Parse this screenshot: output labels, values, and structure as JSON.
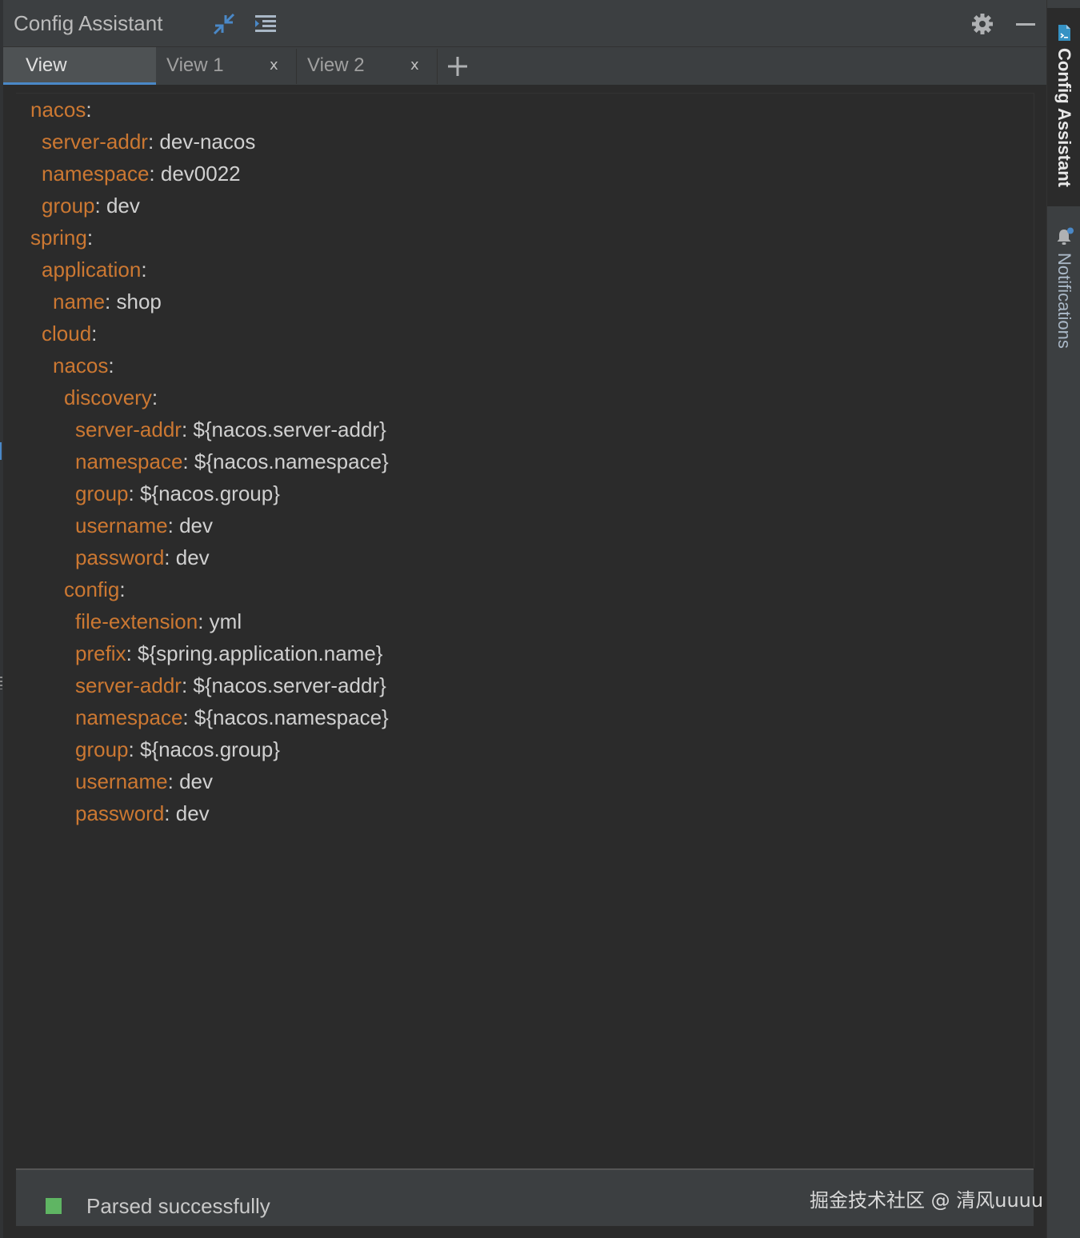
{
  "window": {
    "title": "Config Assistant"
  },
  "toolbar": {
    "collapse_icon": "collapse-arrows-icon",
    "outline_icon": "indent-list-icon",
    "settings_icon": "gear-icon",
    "minimize_icon": "minimize-icon"
  },
  "tabs": [
    {
      "label": "View",
      "active": true,
      "closable": false
    },
    {
      "label": "View 1",
      "active": false,
      "closable": true,
      "close": "x"
    },
    {
      "label": "View 2",
      "active": false,
      "closable": true,
      "close": "x"
    }
  ],
  "add_tab": "+",
  "editor": {
    "lines": [
      {
        "key": "nacos",
        "sep": ":",
        "value": ""
      },
      {
        "key": "server-addr",
        "sep": ":",
        "value": " dev-nacos"
      },
      {
        "key": "namespace",
        "sep": ":",
        "value": " dev0022"
      },
      {
        "key": "group",
        "sep": ":",
        "value": " dev"
      },
      {
        "key": "spring",
        "sep": ":",
        "value": ""
      },
      {
        "key": "application",
        "sep": ":",
        "value": ""
      },
      {
        "key": "name",
        "sep": ":",
        "value": " shop"
      },
      {
        "key": "cloud",
        "sep": ":",
        "value": ""
      },
      {
        "key": "nacos",
        "sep": ":",
        "value": ""
      },
      {
        "key": "discovery",
        "sep": ":",
        "value": ""
      },
      {
        "key": "server-addr",
        "sep": ":",
        "value": " ${nacos.server-addr}"
      },
      {
        "key": "namespace",
        "sep": ":",
        "value": " ${nacos.namespace}"
      },
      {
        "key": "group",
        "sep": ":",
        "value": " ${nacos.group}"
      },
      {
        "key": "username",
        "sep": ":",
        "value": " dev"
      },
      {
        "key": "password",
        "sep": ":",
        "value": " dev"
      },
      {
        "key": "config",
        "sep": ":",
        "value": ""
      },
      {
        "key": "file-extension",
        "sep": ":",
        "value": " yml"
      },
      {
        "key": "prefix",
        "sep": ":",
        "value": " ${spring.application.name}"
      },
      {
        "key": "server-addr",
        "sep": ":",
        "value": " ${nacos.server-addr}"
      },
      {
        "key": "namespace",
        "sep": ":",
        "value": " ${nacos.namespace}"
      },
      {
        "key": "group",
        "sep": ":",
        "value": " ${nacos.group}"
      },
      {
        "key": "username",
        "sep": ":",
        "value": " dev"
      },
      {
        "key": "password",
        "sep": ":",
        "value": " dev"
      }
    ]
  },
  "status": {
    "text": "Parsed successfully",
    "color": "#5fb563"
  },
  "watermark": "掘金技术社区 @ 清风uuuu",
  "side_tabs": {
    "config_assistant": "Config Assistant",
    "notifications": "Notifications"
  },
  "colors": {
    "key": "#cc7832",
    "value": "#d0d0d0",
    "accent": "#4a88c7",
    "background": "#2b2b2b"
  }
}
